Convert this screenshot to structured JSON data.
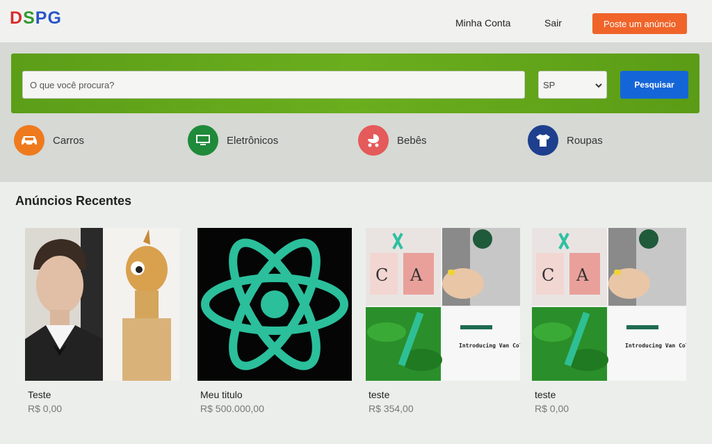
{
  "header": {
    "logo_letters": [
      {
        "char": "D",
        "color": "#d72c2c"
      },
      {
        "char": "S",
        "color": "#2f9a2f"
      },
      {
        "char": "P",
        "color": "#2a55c8"
      },
      {
        "char": "G",
        "color": "#2a55c8"
      }
    ],
    "account_label": "Minha Conta",
    "logout_label": "Sair",
    "post_ad_label": "Poste um anúncio"
  },
  "search": {
    "placeholder": "O que você procura?",
    "state_value": "SP",
    "button_label": "Pesquisar"
  },
  "categories": [
    {
      "label": "Carros",
      "icon": "car-icon",
      "color": "#ef7a1e"
    },
    {
      "label": "Eletrônicos",
      "icon": "monitor-icon",
      "color": "#1f8a3a"
    },
    {
      "label": "Bebês",
      "icon": "baby-stroller-icon",
      "color": "#e55a5a"
    },
    {
      "label": "Roupas",
      "icon": "shirt-icon",
      "color": "#1d3f8e"
    }
  ],
  "recent": {
    "title": "Anúncios Recentes",
    "items": [
      {
        "title": "Teste",
        "price": "R$ 0,00",
        "image": "collage-portrait-and-cartoon"
      },
      {
        "title": "Meu titulo",
        "price": "R$ 500.000,00",
        "image": "react-logo"
      },
      {
        "title": "teste",
        "price": "R$ 354,00",
        "image": "coffee-collage"
      },
      {
        "title": "teste",
        "price": "R$ 0,00",
        "image": "coffee-collage"
      }
    ],
    "coffee_promo_text": "Introducing Van Cold Brew—Sweet Bold."
  }
}
